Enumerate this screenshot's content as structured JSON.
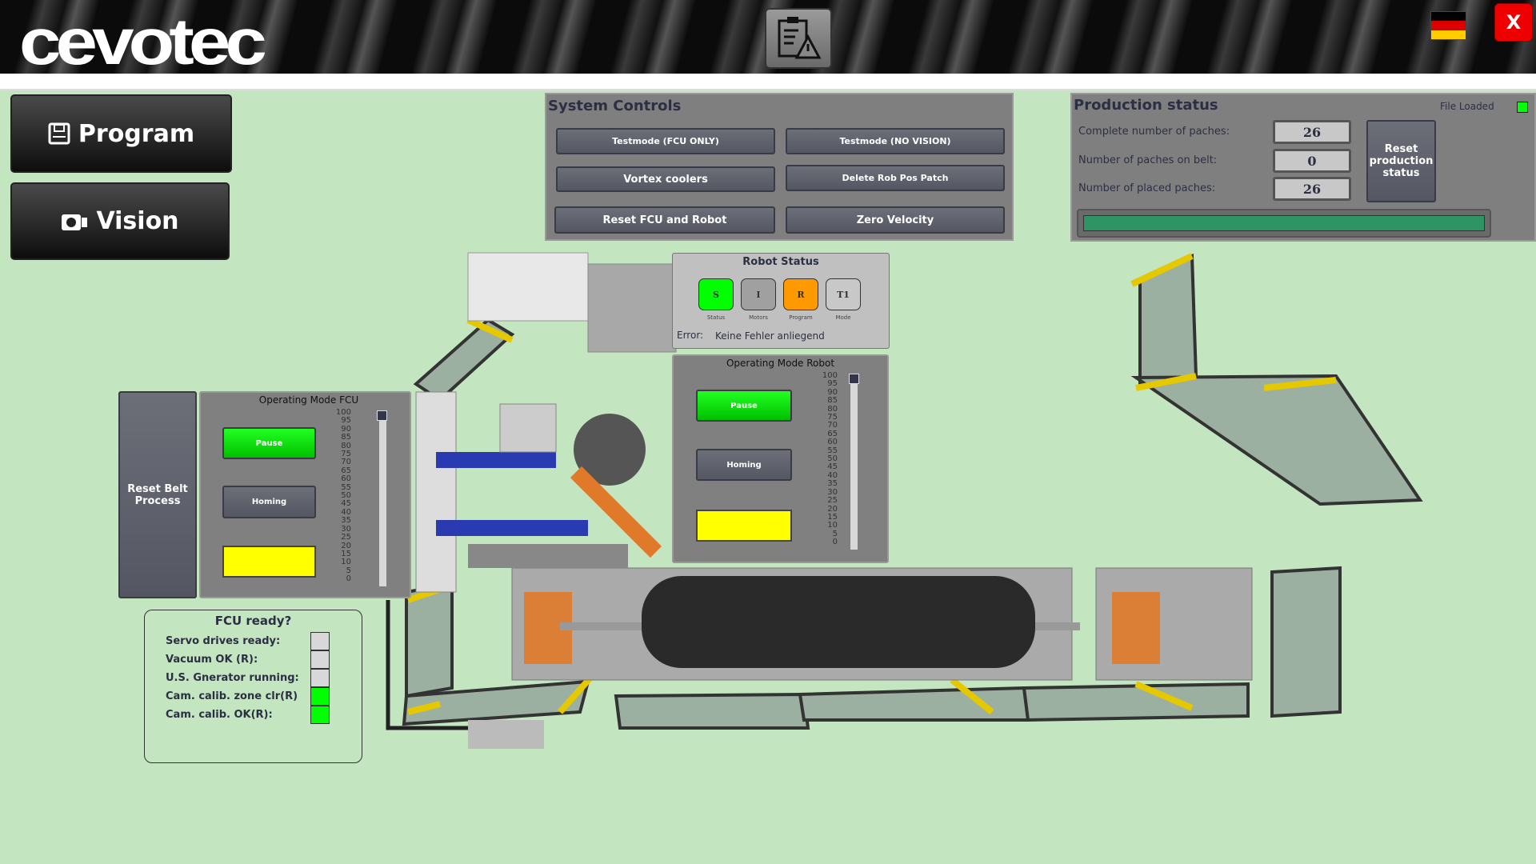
{
  "header": {
    "logo": "cevotec",
    "clipboard_icon": "clipboard-warning-icon",
    "language_flag": "germany-flag",
    "close_label": "X"
  },
  "nav": {
    "program_label": "Program",
    "vision_label": "Vision"
  },
  "system_controls": {
    "title": "System Controls",
    "buttons": [
      "Testmode (FCU ONLY)",
      "Testmode (NO VISION)",
      "Vortex coolers",
      "Delete Rob Pos Patch",
      "Reset FCU and Robot",
      "Zero Velocity"
    ]
  },
  "production_status": {
    "title": "Production status",
    "file_loaded_label": "File Loaded",
    "file_loaded_color": "#00ff00",
    "rows": [
      {
        "label": "Complete number of paches:",
        "value": "26"
      },
      {
        "label": "Number of paches on belt:",
        "value": "0"
      },
      {
        "label": "Number of placed paches:",
        "value": "26"
      }
    ],
    "reset_label": "Reset production status",
    "progress_percent": 100,
    "progress_color": "#2e9463"
  },
  "robot_status": {
    "title": "Robot Status",
    "indicators": [
      {
        "letter": "S",
        "label": "Status",
        "color": "#00ff00"
      },
      {
        "letter": "I",
        "label": "Motors",
        "color": "#a0a0a0"
      },
      {
        "letter": "R",
        "label": "Program",
        "color": "#ff9900"
      },
      {
        "letter": "T1",
        "label": "Mode",
        "color": "#c8c8c8"
      }
    ],
    "error_label": "Error:",
    "error_text": "Keine Fehler anliegend"
  },
  "operating_mode_robot": {
    "title": "Operating Mode Robot",
    "pause_label": "Pause",
    "homing_label": "Homing",
    "slider_value": 100,
    "scale": [
      "100",
      "95",
      "90",
      "85",
      "80",
      "75",
      "70",
      "65",
      "60",
      "55",
      "50",
      "45",
      "40",
      "35",
      "30",
      "25",
      "20",
      "15",
      "10",
      "5",
      "0"
    ]
  },
  "operating_mode_fcu": {
    "title": "Operating Mode FCU",
    "pause_label": "Pause",
    "homing_label": "Homing",
    "slider_value": 100,
    "scale": [
      "100",
      "95",
      "90",
      "85",
      "80",
      "75",
      "70",
      "65",
      "60",
      "55",
      "50",
      "45",
      "40",
      "35",
      "30",
      "25",
      "20",
      "15",
      "10",
      "5",
      "0"
    ]
  },
  "reset_belt": {
    "label": "Reset Belt Process"
  },
  "fcu_ready": {
    "title": "FCU ready?",
    "items": [
      {
        "label": "Servo drives ready:",
        "color": "#d8d8d8"
      },
      {
        "label": "Vacuum OK (R):",
        "color": "#d8d8d8"
      },
      {
        "label": "U.S. Gnerator running:",
        "color": "#d8d8d8"
      },
      {
        "label": "Cam. calib. zone clr(R)",
        "color": "#00ff00"
      },
      {
        "label": "Cam. calib. OK(R):",
        "color": "#00ff00"
      }
    ]
  }
}
